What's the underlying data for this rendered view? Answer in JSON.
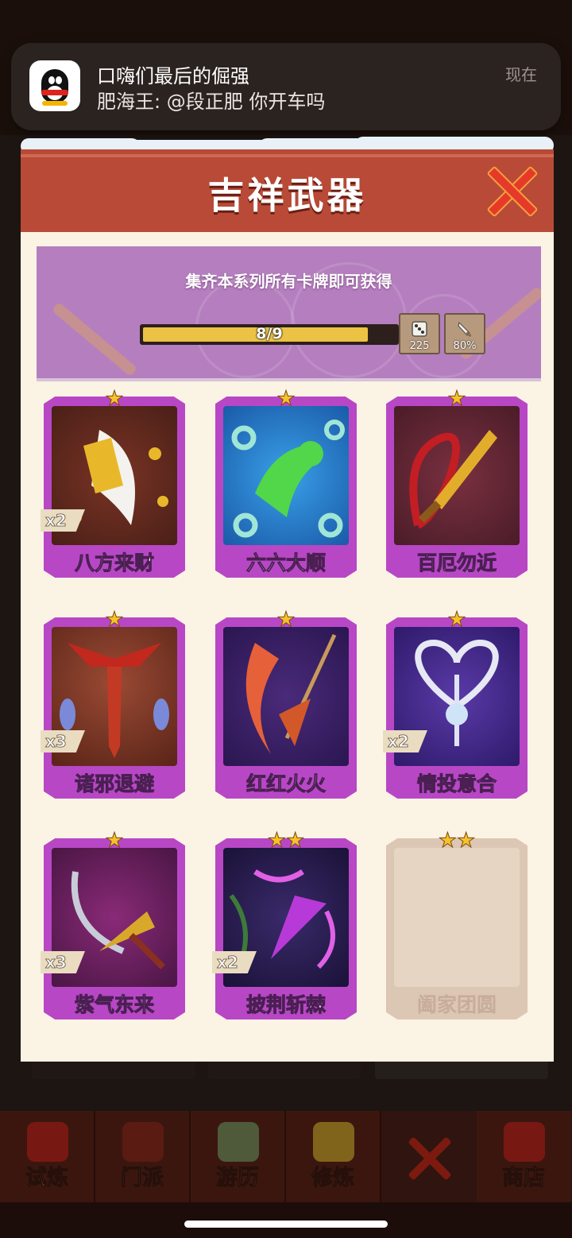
{
  "notification": {
    "app_icon": "qq-penguin-icon",
    "title": "口嗨们最后的倔强",
    "message": "肥海王: @段正肥 你开车吗",
    "time": "现在"
  },
  "dialog": {
    "title": "吉祥武器",
    "close_icon": "close-x-icon",
    "banner_text": "集齐本系列所有卡牌即可获得",
    "progress": {
      "text": "8/9",
      "fraction": 0.889
    },
    "bonuses": [
      {
        "icon": "dice-icon",
        "value": "225"
      },
      {
        "icon": "sword-icon",
        "value": "80%"
      }
    ],
    "cards": [
      {
        "name": "八方来财",
        "stars": 1,
        "count": "x2",
        "locked": false,
        "icon": "golden-blade-icon"
      },
      {
        "name": "六六大顺",
        "stars": 1,
        "count": "",
        "locked": false,
        "icon": "six-hand-icon"
      },
      {
        "name": "百厄勿近",
        "stars": 1,
        "count": "",
        "locked": false,
        "icon": "golden-sword-icon"
      },
      {
        "name": "诸邪退避",
        "stars": 1,
        "count": "x3",
        "locked": false,
        "icon": "red-sword-icon"
      },
      {
        "name": "红红火火",
        "stars": 1,
        "count": "",
        "locked": false,
        "icon": "fire-spear-icon"
      },
      {
        "name": "情投意合",
        "stars": 1,
        "count": "x2",
        "locked": false,
        "icon": "heart-key-icon"
      },
      {
        "name": "紫气东来",
        "stars": 1,
        "count": "x3",
        "locked": false,
        "icon": "crossbow-icon"
      },
      {
        "name": "披荆斩棘",
        "stars": 2,
        "count": "x2",
        "locked": false,
        "icon": "purple-spear-icon"
      },
      {
        "name": "阖家团圆",
        "stars": 2,
        "count": "",
        "locked": true,
        "icon": ""
      }
    ]
  },
  "bottom_nav": [
    {
      "label": "试炼",
      "icon": "trial-icon"
    },
    {
      "label": "门派",
      "icon": "sect-icon"
    },
    {
      "label": "游历",
      "icon": "travel-icon"
    },
    {
      "label": "修炼",
      "icon": "cultivate-icon"
    },
    {
      "label": "",
      "icon": "close-x-icon"
    },
    {
      "label": "商店",
      "icon": "shop-icon"
    }
  ],
  "colors": {
    "header": "#b84a37",
    "card_frame": "#b847c6",
    "banner": "#b57fbf",
    "progress_fill": "#ecc245",
    "star": "#f6c22c"
  }
}
